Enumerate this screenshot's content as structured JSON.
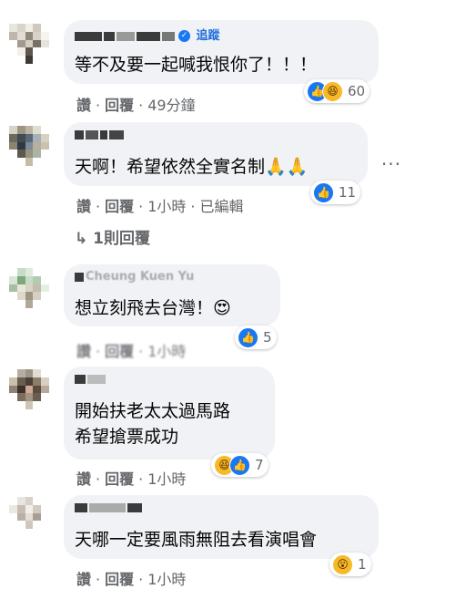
{
  "comments": [
    {
      "author_visible": "追蹤",
      "text": "等不及要一起喊我恨你了！！！",
      "actions": {
        "like": "讚",
        "reply": "回覆",
        "time": "49分鐘"
      },
      "reactions": {
        "icons": [
          "like-icon",
          "haha-icon"
        ],
        "count": "60"
      }
    },
    {
      "author_visible": "",
      "text": "天啊！希望依然全實名制🙏🙏",
      "actions": {
        "like": "讚",
        "reply": "回覆",
        "time": "1小時",
        "edited": "已編輯"
      },
      "reactions": {
        "icons": [
          "like-icon"
        ],
        "count": "11"
      },
      "replies_link": "↳ 1則回覆"
    },
    {
      "author_visible": "Cheung Kuen Yu",
      "text": "想立刻飛去台灣！😍",
      "actions": {
        "like": "讚",
        "reply": "回覆",
        "time": "1小時"
      },
      "reactions": {
        "icons": [
          "like-icon"
        ],
        "count": "5"
      }
    },
    {
      "author_visible": "",
      "text_lines": [
        "開始扶老太太過馬路",
        "希望搶票成功"
      ],
      "actions": {
        "like": "讚",
        "reply": "回覆",
        "time": "1小時"
      },
      "reactions": {
        "icons": [
          "haha-icon",
          "like-icon"
        ],
        "count": "7"
      }
    },
    {
      "author_visible": "",
      "text": "天哪一定要風雨無阻去看演唱會",
      "actions": {
        "like": "讚",
        "reply": "回覆",
        "time": "1小時"
      },
      "reactions": {
        "icons": [
          "wow-icon"
        ],
        "count": "1"
      }
    }
  ],
  "more_menu": "...",
  "colors": {
    "bubble": "#f0f2f5",
    "link": "#216fdb",
    "meta": "#65676b",
    "like": "#1877f2",
    "emoji": "#f7b928"
  }
}
